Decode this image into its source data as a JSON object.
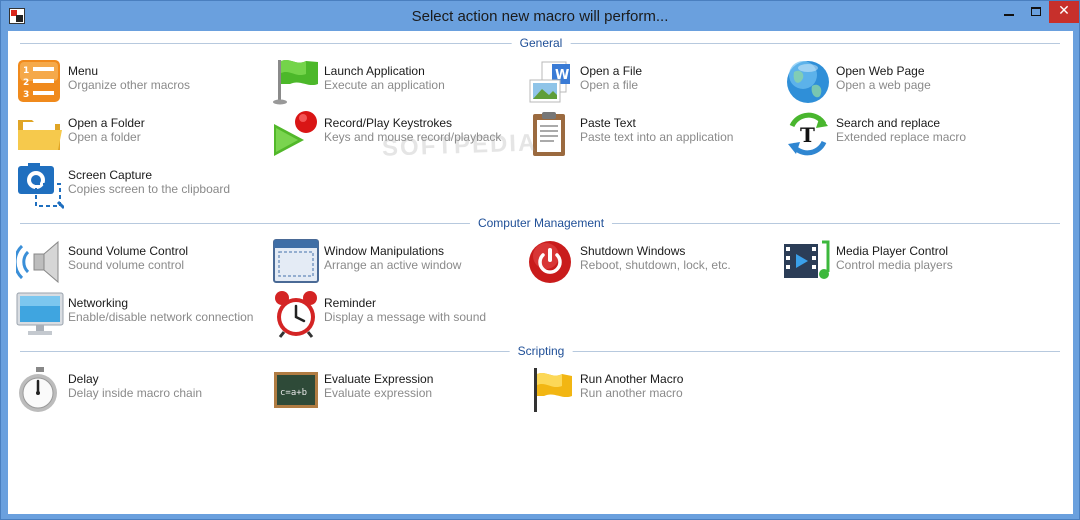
{
  "window": {
    "title": "Select action new macro will perform..."
  },
  "watermark": "SOFTPEDIA",
  "sections": {
    "general": {
      "title": "General",
      "items": {
        "menu": {
          "label": "Menu",
          "desc": "Organize other macros",
          "icon": "numbered-list-icon"
        },
        "launch": {
          "label": "Launch Application",
          "desc": "Execute an application",
          "icon": "green-flag-icon"
        },
        "openfile": {
          "label": "Open a File",
          "desc": "Open a file",
          "icon": "documents-icon"
        },
        "openweb": {
          "label": "Open Web Page",
          "desc": "Open a web page",
          "icon": "globe-icon"
        },
        "openfolder": {
          "label": "Open a Folder",
          "desc": "Open a folder",
          "icon": "folder-icon"
        },
        "record": {
          "label": "Record/Play Keystrokes",
          "desc": "Keys and mouse record/playback",
          "icon": "record-play-icon"
        },
        "paste": {
          "label": "Paste Text",
          "desc": "Paste text into an application",
          "icon": "clipboard-icon"
        },
        "search": {
          "label": "Search and replace",
          "desc": "Extended replace macro",
          "icon": "search-replace-icon"
        },
        "capture": {
          "label": "Screen Capture",
          "desc": "Copies screen to the clipboard",
          "icon": "camera-icon"
        }
      }
    },
    "computer": {
      "title": "Computer Management",
      "items": {
        "volume": {
          "label": "Sound Volume Control",
          "desc": "Sound volume control",
          "icon": "speaker-icon"
        },
        "window": {
          "label": "Window Manipulations",
          "desc": "Arrange an active window",
          "icon": "window-icon"
        },
        "shutdown": {
          "label": "Shutdown Windows",
          "desc": "Reboot, shutdown, lock, etc.",
          "icon": "power-icon"
        },
        "media": {
          "label": "Media Player Control",
          "desc": "Control media players",
          "icon": "media-film-icon"
        },
        "network": {
          "label": "Networking",
          "desc": "Enable/disable network connection",
          "icon": "monitor-icon"
        },
        "reminder": {
          "label": "Reminder",
          "desc": "Display a message with sound",
          "icon": "alarm-clock-icon"
        }
      }
    },
    "scripting": {
      "title": "Scripting",
      "items": {
        "delay": {
          "label": "Delay",
          "desc": "Delay inside macro chain",
          "icon": "stopwatch-icon"
        },
        "evaluate": {
          "label": "Evaluate Expression",
          "desc": "Evaluate expression",
          "icon": "chalkboard-icon"
        },
        "runmacro": {
          "label": "Run Another Macro",
          "desc": "Run another macro",
          "icon": "yellow-flag-icon"
        }
      }
    }
  },
  "colors": {
    "titlebar": "#6aa0de",
    "section_title": "#1f4f97",
    "close": "#c7302b"
  }
}
